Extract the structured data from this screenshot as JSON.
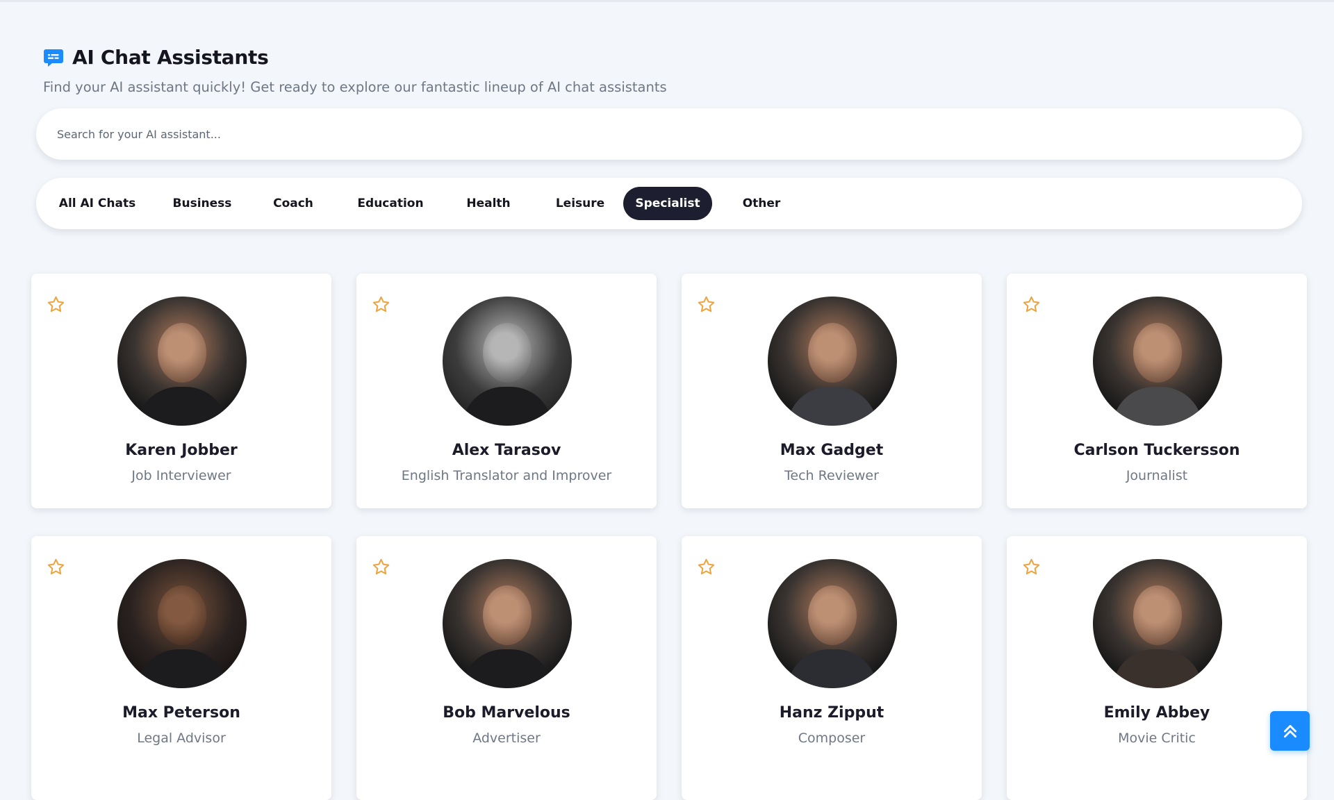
{
  "header": {
    "icon": "chat-bubble-icon",
    "title": "AI Chat Assistants",
    "subtitle": "Find your AI assistant quickly! Get ready to explore our fantastic lineup of AI chat assistants"
  },
  "search": {
    "placeholder": "Search for your AI assistant...",
    "value": ""
  },
  "tabs": {
    "items": [
      "All AI Chats",
      "Business",
      "Coach",
      "Education",
      "Health",
      "Leisure",
      "Specialist",
      "Other"
    ],
    "active": "Specialist"
  },
  "assistants": [
    {
      "name": "Karen Jobber",
      "role": "Job Interviewer"
    },
    {
      "name": "Alex Tarasov",
      "role": "English Translator and Improver"
    },
    {
      "name": "Max Gadget",
      "role": "Tech Reviewer"
    },
    {
      "name": "Carlson Tuckersson",
      "role": "Journalist"
    },
    {
      "name": "Max Peterson",
      "role": "Legal Advisor"
    },
    {
      "name": "Bob Marvelous",
      "role": "Advertiser"
    },
    {
      "name": "Hanz Zipput",
      "role": "Composer"
    },
    {
      "name": "Emily Abbey",
      "role": "Movie Critic"
    }
  ],
  "icons": {
    "favorite": "star-outline-icon",
    "scroll_top": "double-chevron-up-icon"
  },
  "colors": {
    "accent": "#1a8cff",
    "star": "#f0a33a",
    "active_tab": "#1d1e2f",
    "background": "#f3f6fa"
  }
}
